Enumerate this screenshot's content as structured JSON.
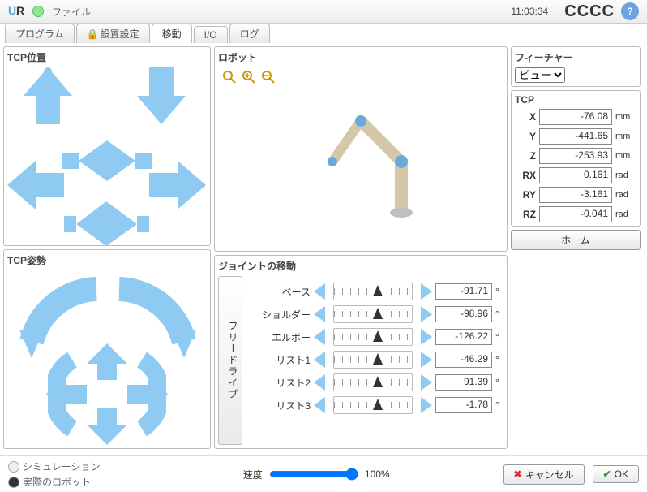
{
  "topbar": {
    "file": "ファイル",
    "time": "11:03:34",
    "cccc": "CCCC"
  },
  "tabs": {
    "program": "プログラム",
    "install": "設置設定",
    "move": "移動",
    "io": "I/O",
    "log": "ログ"
  },
  "panels": {
    "tcp_pos": "TCP位置",
    "tcp_ori": "TCP姿勢",
    "robot": "ロボット",
    "joint_move": "ジョイントの移動",
    "feature": "フィーチャー",
    "tcp": "TCP"
  },
  "feature": {
    "selected": "ビュー"
  },
  "tcp": {
    "x_lbl": "X",
    "x_val": "-76.08",
    "x_unit": "mm",
    "y_lbl": "Y",
    "y_val": "-441.65",
    "y_unit": "mm",
    "z_lbl": "Z",
    "z_val": "-253.93",
    "z_unit": "mm",
    "rx_lbl": "RX",
    "rx_val": "0.161",
    "rx_unit": "rad",
    "ry_lbl": "RY",
    "ry_val": "-3.161",
    "ry_unit": "rad",
    "rz_lbl": "RZ",
    "rz_val": "-0.041",
    "rz_unit": "rad"
  },
  "home": "ホーム",
  "freedrive": "フリードライブ",
  "joints": [
    {
      "label": "ベース",
      "value": "-91.71",
      "unit": "°",
      "pos": 50
    },
    {
      "label": "ショルダー",
      "value": "-98.96",
      "unit": "°",
      "pos": 50
    },
    {
      "label": "エルボー",
      "value": "-126.22",
      "unit": "°",
      "pos": 50
    },
    {
      "label": "リスト1",
      "value": "-46.29",
      "unit": "°",
      "pos": 50
    },
    {
      "label": "リスト2",
      "value": "91.39",
      "unit": "°",
      "pos": 50
    },
    {
      "label": "リスト3",
      "value": "-1.78",
      "unit": "°",
      "pos": 50
    }
  ],
  "footer": {
    "sim": "シミュレーション",
    "real": "実際のロボット",
    "speed": "速度",
    "speed_val": "100%",
    "cancel": "キャンセル",
    "ok": "OK"
  }
}
